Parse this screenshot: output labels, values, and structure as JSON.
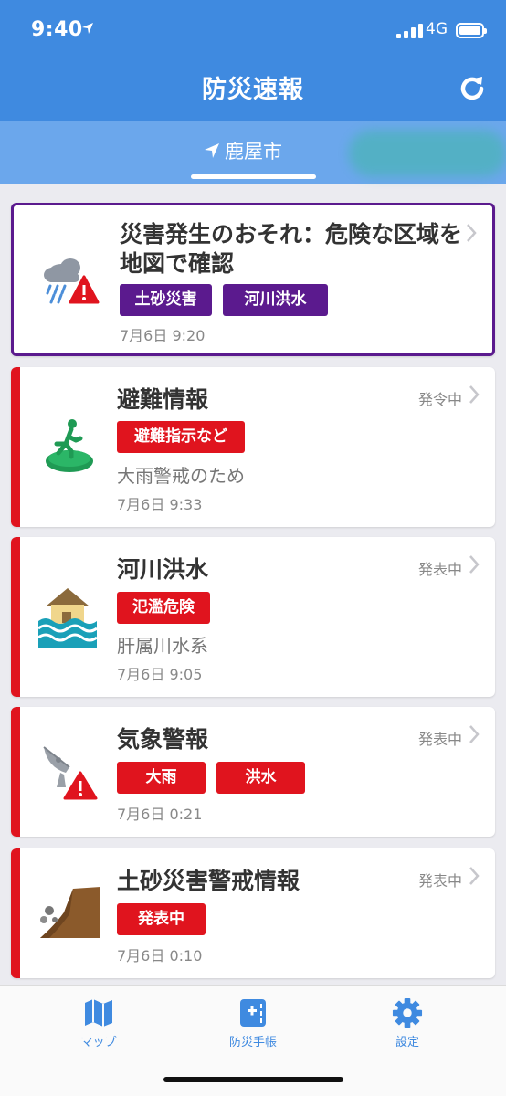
{
  "status_bar": {
    "time": "9:40",
    "network": "4G"
  },
  "header": {
    "title": "防災速報"
  },
  "location_tab": {
    "label": "鹿屋市"
  },
  "cards": [
    {
      "title_line1": "災害発生のおそれ：危険な区域を",
      "title_line2": "地図で確認",
      "tags": [
        "土砂災害",
        "河川洪水"
      ],
      "date": "7月6日 9:20"
    },
    {
      "title": "避難情報",
      "state": "発令中",
      "tags": [
        "避難指示など"
      ],
      "description": "大雨警戒のため",
      "date": "7月6日 9:33"
    },
    {
      "title": "河川洪水",
      "state": "発表中",
      "tags": [
        "氾濫危険"
      ],
      "description": "肝属川水系",
      "date": "7月6日 9:05"
    },
    {
      "title": "気象警報",
      "state": "発表中",
      "tags": [
        "大雨",
        "洪水"
      ],
      "date": "7月6日 0:21"
    },
    {
      "title": "土砂災害警戒情報",
      "state": "発表中",
      "tags": [
        "発表中"
      ],
      "date": "7月6日 0:10"
    }
  ],
  "bottom_nav": [
    {
      "label": "マップ",
      "icon": "map-icon"
    },
    {
      "label": "防災手帳",
      "icon": "notebook-icon"
    },
    {
      "label": "設定",
      "icon": "gear-icon"
    }
  ],
  "colors": {
    "header": "#3f8ae0",
    "tab_bar": "#6ba7ec",
    "alert_purple": "#5b1a8e",
    "warning_red": "#e0141e"
  }
}
